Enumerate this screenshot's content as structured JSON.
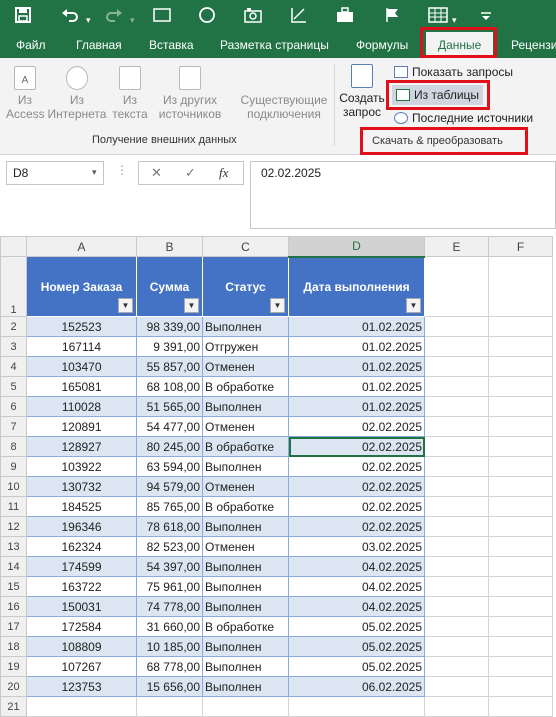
{
  "qat": {
    "icons": [
      "save-icon",
      "undo-icon",
      "redo-icon",
      "ellipse-icon",
      "camera-icon",
      "chart-icon",
      "toolbox-icon",
      "grid-icon",
      "dropdown-icon"
    ]
  },
  "tabs": [
    {
      "label": "Файл",
      "active": false
    },
    {
      "label": "Главная",
      "active": false
    },
    {
      "label": "Вставка",
      "active": false
    },
    {
      "label": "Разметка страницы",
      "active": false
    },
    {
      "label": "Формулы",
      "active": false
    },
    {
      "label": "Данные",
      "active": true
    },
    {
      "label": "Рецензи",
      "active": false
    }
  ],
  "ribbon": {
    "get_external": {
      "buttons": [
        {
          "line1": "Из",
          "line2": "Access",
          "icon": "access-icon"
        },
        {
          "line1": "Из",
          "line2": "Интернета",
          "icon": "globe-icon"
        },
        {
          "line1": "Из",
          "line2": "текста",
          "icon": "text-file-icon"
        },
        {
          "line1": "Из других",
          "line2": "источников",
          "icon": "other-sources-icon"
        },
        {
          "line1": "Существующие",
          "line2": "подключения",
          "icon": "connections-icon"
        }
      ],
      "group_label": "Получение внешних данных"
    },
    "transform": {
      "create_query": {
        "line1": "Создать",
        "line2": "запрос"
      },
      "show_queries": "Показать запросы",
      "from_table": "Из таблицы",
      "recent_sources": "Последние источники",
      "group_label": "Скачать & преобразовать"
    }
  },
  "formula_bar": {
    "name_box": "D8",
    "cancel": "✕",
    "enter": "✓",
    "fx": "fx",
    "value": "02.02.2025"
  },
  "sheet": {
    "columns": [
      "A",
      "B",
      "C",
      "D",
      "E",
      "F"
    ],
    "header_row": "1",
    "headers": [
      "Номер Заказа",
      "Сумма",
      "Статус",
      "Дата выполнения"
    ],
    "rows": [
      {
        "n": "2",
        "a": "152523",
        "b": "98 339,00",
        "c": "Выполнен",
        "d": "01.02.2025"
      },
      {
        "n": "3",
        "a": "167114",
        "b": "9 391,00",
        "c": "Отгружен",
        "d": "01.02.2025"
      },
      {
        "n": "4",
        "a": "103470",
        "b": "55 857,00",
        "c": "Отменен",
        "d": "01.02.2025"
      },
      {
        "n": "5",
        "a": "165081",
        "b": "68 108,00",
        "c": "В обработке",
        "d": "01.02.2025"
      },
      {
        "n": "6",
        "a": "110028",
        "b": "51 565,00",
        "c": "Выполнен",
        "d": "01.02.2025"
      },
      {
        "n": "7",
        "a": "120891",
        "b": "54 477,00",
        "c": "Отменен",
        "d": "02.02.2025"
      },
      {
        "n": "8",
        "a": "128927",
        "b": "80 245,00",
        "c": "В обработке",
        "d": "02.02.2025"
      },
      {
        "n": "9",
        "a": "103922",
        "b": "63 594,00",
        "c": "Выполнен",
        "d": "02.02.2025"
      },
      {
        "n": "10",
        "a": "130732",
        "b": "94 579,00",
        "c": "Отменен",
        "d": "02.02.2025"
      },
      {
        "n": "11",
        "a": "184525",
        "b": "85 765,00",
        "c": "В обработке",
        "d": "02.02.2025"
      },
      {
        "n": "12",
        "a": "196346",
        "b": "78 618,00",
        "c": "Выполнен",
        "d": "02.02.2025"
      },
      {
        "n": "13",
        "a": "162324",
        "b": "82 523,00",
        "c": "Отменен",
        "d": "03.02.2025"
      },
      {
        "n": "14",
        "a": "174599",
        "b": "54 397,00",
        "c": "Выполнен",
        "d": "04.02.2025"
      },
      {
        "n": "15",
        "a": "163722",
        "b": "75 961,00",
        "c": "Выполнен",
        "d": "04.02.2025"
      },
      {
        "n": "16",
        "a": "150031",
        "b": "74 778,00",
        "c": "Выполнен",
        "d": "04.02.2025"
      },
      {
        "n": "17",
        "a": "172584",
        "b": "31 660,00",
        "c": "В обработке",
        "d": "05.02.2025"
      },
      {
        "n": "18",
        "a": "108809",
        "b": "10 185,00",
        "c": "Выполнен",
        "d": "05.02.2025"
      },
      {
        "n": "19",
        "a": "107267",
        "b": "68 778,00",
        "c": "Выполнен",
        "d": "05.02.2025"
      },
      {
        "n": "20",
        "a": "123753",
        "b": "15 656,00",
        "c": "Выполнен",
        "d": "06.02.2025"
      }
    ],
    "last_row": "21",
    "active_cell": "D8"
  },
  "colors": {
    "excel_green": "#217346",
    "table_header": "#4472c4",
    "band": "#dce6f2",
    "highlight": "#e0101a"
  }
}
